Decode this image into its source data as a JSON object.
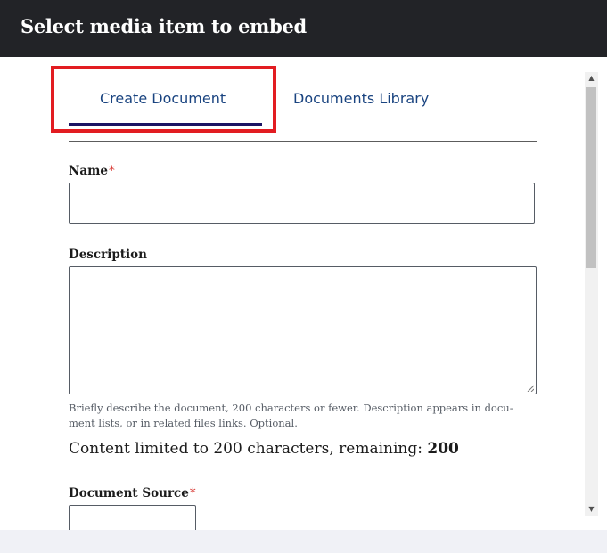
{
  "header": {
    "title": "Select media item to embed"
  },
  "tabs": [
    {
      "label": "Create Document",
      "active": true
    },
    {
      "label": "Documents Library",
      "active": false
    }
  ],
  "form": {
    "name_label": "Name",
    "name_required_mark": "*",
    "name_value": "",
    "description_label": "Description",
    "description_value": "",
    "description_help": "Briefly describe the document, 200 characters or fewer. Description appears in docu-ment lists, or in related files links. Optional.",
    "limit_prefix": "Content limited to 200 characters, remaining: ",
    "limit_remaining": "200",
    "source_label": "Document Source",
    "source_required_mark": "*"
  },
  "colors": {
    "header_bg": "#222327",
    "tab_text": "#1a4480",
    "active_underline": "#1b1464",
    "highlight": "#e21c21",
    "required": "#d83933",
    "footer_bg": "#f0f1f6"
  },
  "icons": {
    "scroll_up": "▲",
    "scroll_down": "▼"
  }
}
